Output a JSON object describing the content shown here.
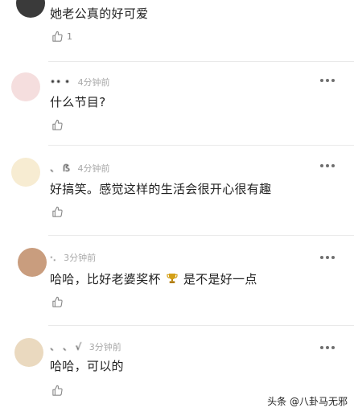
{
  "comments": [
    {
      "text": "她老公真的好可爱",
      "like_count": "1",
      "avatar_color": "#3a3a3a"
    },
    {
      "name": "•• •",
      "time": "4分钟前",
      "text": "什么节目?",
      "avatar_color": "#f2d6d6"
    },
    {
      "name": "、 ẞ",
      "time": "4分钟前",
      "text": "好搞笑。感觉这样的生活会很开心很有趣",
      "avatar_color": "#f3e7c9"
    },
    {
      "name": "·.",
      "time": "3分钟前",
      "text_before_icon": "哈哈，比好老婆奖杯",
      "text_after_icon": "是不是好一点",
      "avatar_color": "#c79a7a"
    },
    {
      "name": "、 、 √",
      "time": "3分钟前",
      "text": "哈哈，可以的",
      "avatar_color": "#e7d8c0"
    }
  ],
  "icons": {
    "like": "thumbs-up-icon",
    "more": "more-horizontal-icon",
    "trophy": "trophy-icon"
  },
  "colors": {
    "text": "#222222",
    "meta": "#a8a8a8",
    "icon": "#8a8a8a",
    "trophy": "#d4a017"
  },
  "watermark": "头条 @八卦马无邪"
}
